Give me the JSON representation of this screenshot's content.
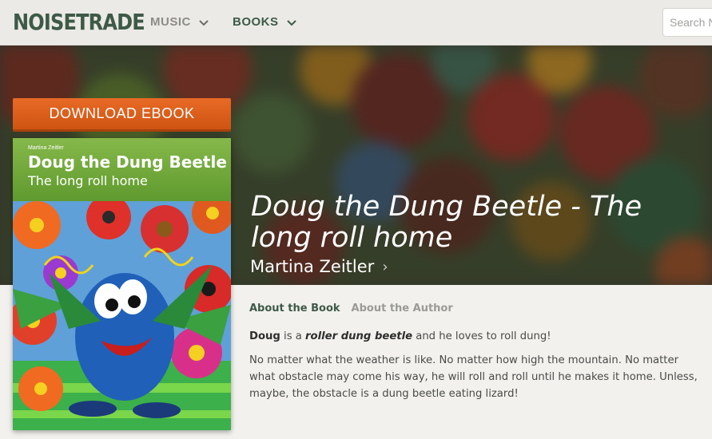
{
  "header": {
    "logo": "NOISETRADE",
    "nav": [
      {
        "label": "MUSIC"
      },
      {
        "label": "BOOKS"
      }
    ],
    "search_placeholder": "Search N"
  },
  "book": {
    "download_label": "DOWNLOAD EBOOK",
    "title": "Doug the Dung Beetle - The long roll home",
    "author": "Martina Zeitler"
  },
  "cover": {
    "author": "Martina Zeitler",
    "title": "Doug the Dung Beetle",
    "subtitle": "The long roll home"
  },
  "tabs": [
    {
      "label": "About the Book",
      "active": true
    },
    {
      "label": "About the Author",
      "active": false
    }
  ],
  "description": {
    "p1_name": "Doug",
    "p1_text_a": " is a ",
    "p1_emphasis": "roller dung beetle",
    "p1_text_b": " and he loves to roll dung!",
    "p2": "No matter what the weather is like. No matter how high the mountain. No matter what obstacle may come his way, he will roll and roll until he makes it home. Unless, maybe, the obstacle is a dung beetle eating lizard!"
  },
  "colors": {
    "brand_green": "#3e5a47",
    "download_orange": "#e0621f",
    "cover_green": "#6fa83a"
  }
}
